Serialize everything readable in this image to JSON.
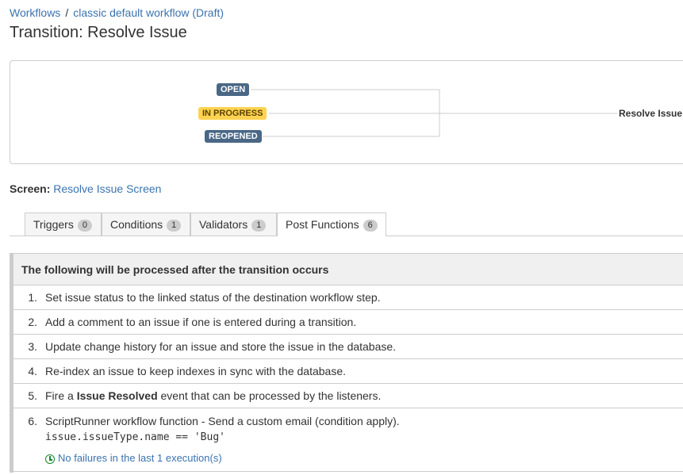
{
  "breadcrumbs": {
    "root": "Workflows",
    "separator": "/",
    "current": "classic default workflow (Draft)"
  },
  "page_title": "Transition: Resolve Issue",
  "diagram": {
    "statuses": [
      {
        "label": "OPEN",
        "color": "#4a6785"
      },
      {
        "label": "IN PROGRESS",
        "color": "#ffd351"
      },
      {
        "label": "REOPENED",
        "color": "#4a6785"
      }
    ],
    "transition_label": "Resolve Issue"
  },
  "screen": {
    "label": "Screen:",
    "value": "Resolve Issue Screen"
  },
  "tabs": [
    {
      "label": "Triggers",
      "count": "0"
    },
    {
      "label": "Conditions",
      "count": "1"
    },
    {
      "label": "Validators",
      "count": "1"
    },
    {
      "label": "Post Functions",
      "count": "6",
      "active": true
    }
  ],
  "post_functions": {
    "header": "The following will be processed after the transition occurs",
    "items": [
      {
        "num": "1.",
        "text": "Set issue status to the linked status of the destination workflow step."
      },
      {
        "num": "2.",
        "text": "Add a comment to an issue if one is entered during a transition."
      },
      {
        "num": "3.",
        "text": "Update change history for an issue and store the issue in the database."
      },
      {
        "num": "4.",
        "text": "Re-index an issue to keep indexes in sync with the database."
      },
      {
        "num": "5.",
        "text_before": "Fire a",
        "text_bold": "Issue Resolved",
        "text_after": "event that can be processed by the listeners."
      },
      {
        "num": "6.",
        "text": "ScriptRunner workflow function - Send a custom email (condition apply).",
        "code": "issue.issueType.name == 'Bug'",
        "status": "No failures in the last 1 execution(s)"
      }
    ]
  },
  "colors": {
    "link": "#3b73af",
    "success": "#14892c",
    "status_blue": "#4a6785",
    "status_yellow": "#ffd351"
  }
}
